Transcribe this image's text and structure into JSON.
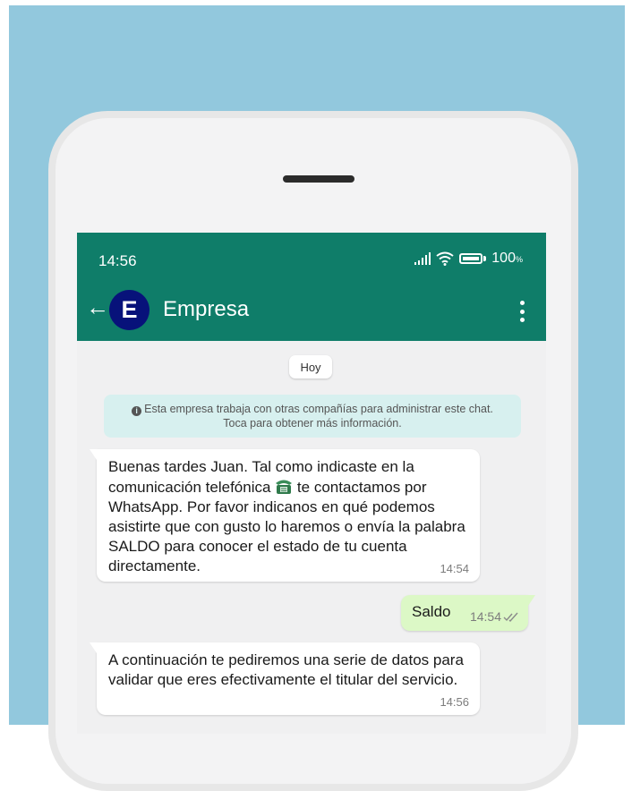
{
  "status_bar": {
    "time": "14:56",
    "battery_text": "100",
    "battery_suffix": "%"
  },
  "header": {
    "avatar_letter": "E",
    "contact_name": "Empresa",
    "back_icon": "arrow-left-icon",
    "menu_icon": "more-vertical-icon"
  },
  "chat": {
    "day_label": "Hoy",
    "notice_line1": "Esta empresa trabaja con otras compañías para administrar este chat.",
    "notice_line2": "Toca para obtener más información.",
    "messages": [
      {
        "direction": "incoming",
        "text_before_emoji": "Buenas tardes Juan. Tal como indicaste en la comunicación telefónica",
        "emoji": "telephone-icon",
        "text_after_emoji": "te contactamos por WhatsApp. Por favor indicanos en qué podemos asistirte que con gusto lo haremos o envía la palabra SALDO para conocer el estado de tu cuenta directamente.",
        "time": "14:54"
      },
      {
        "direction": "outgoing",
        "text": "Saldo",
        "time": "14:54",
        "status_icon": "double-check-icon"
      },
      {
        "direction": "incoming",
        "text": "A continuación te pediremos una serie de datos para validar que eres efectivamente el titular del servicio.",
        "time": "14:56"
      }
    ]
  },
  "colors": {
    "background": "#92c8dd",
    "header": "#0f7d69",
    "avatar": "#07127a",
    "outgoing_bubble": "#dcf8c6",
    "notice": "#d7f0ef"
  }
}
